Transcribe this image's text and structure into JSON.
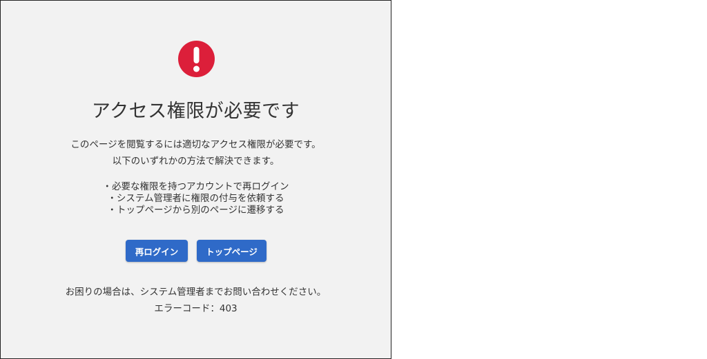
{
  "colors": {
    "alert": "#dc1f3a",
    "button": "#2f6ac8",
    "panel_background": "#f2f2f2",
    "text": "#333333"
  },
  "icon": "exclamation-circle-icon",
  "title": "アクセス権限が必要です",
  "description": {
    "line1": "このページを閲覧するには適切なアクセス権限が必要です。",
    "line2": "以下のいずれかの方法で解決できます。"
  },
  "options": [
    "・必要な権限を持つアカウントで再ログイン",
    "・システム管理者に権限の付与を依頼する",
    "・トップページから別のページに遷移する"
  ],
  "buttons": {
    "relogin": "再ログイン",
    "top_page": "トップページ"
  },
  "help_text": "お困りの場合は、システム管理者までお問い合わせください。",
  "error_code": "エラーコード：403"
}
